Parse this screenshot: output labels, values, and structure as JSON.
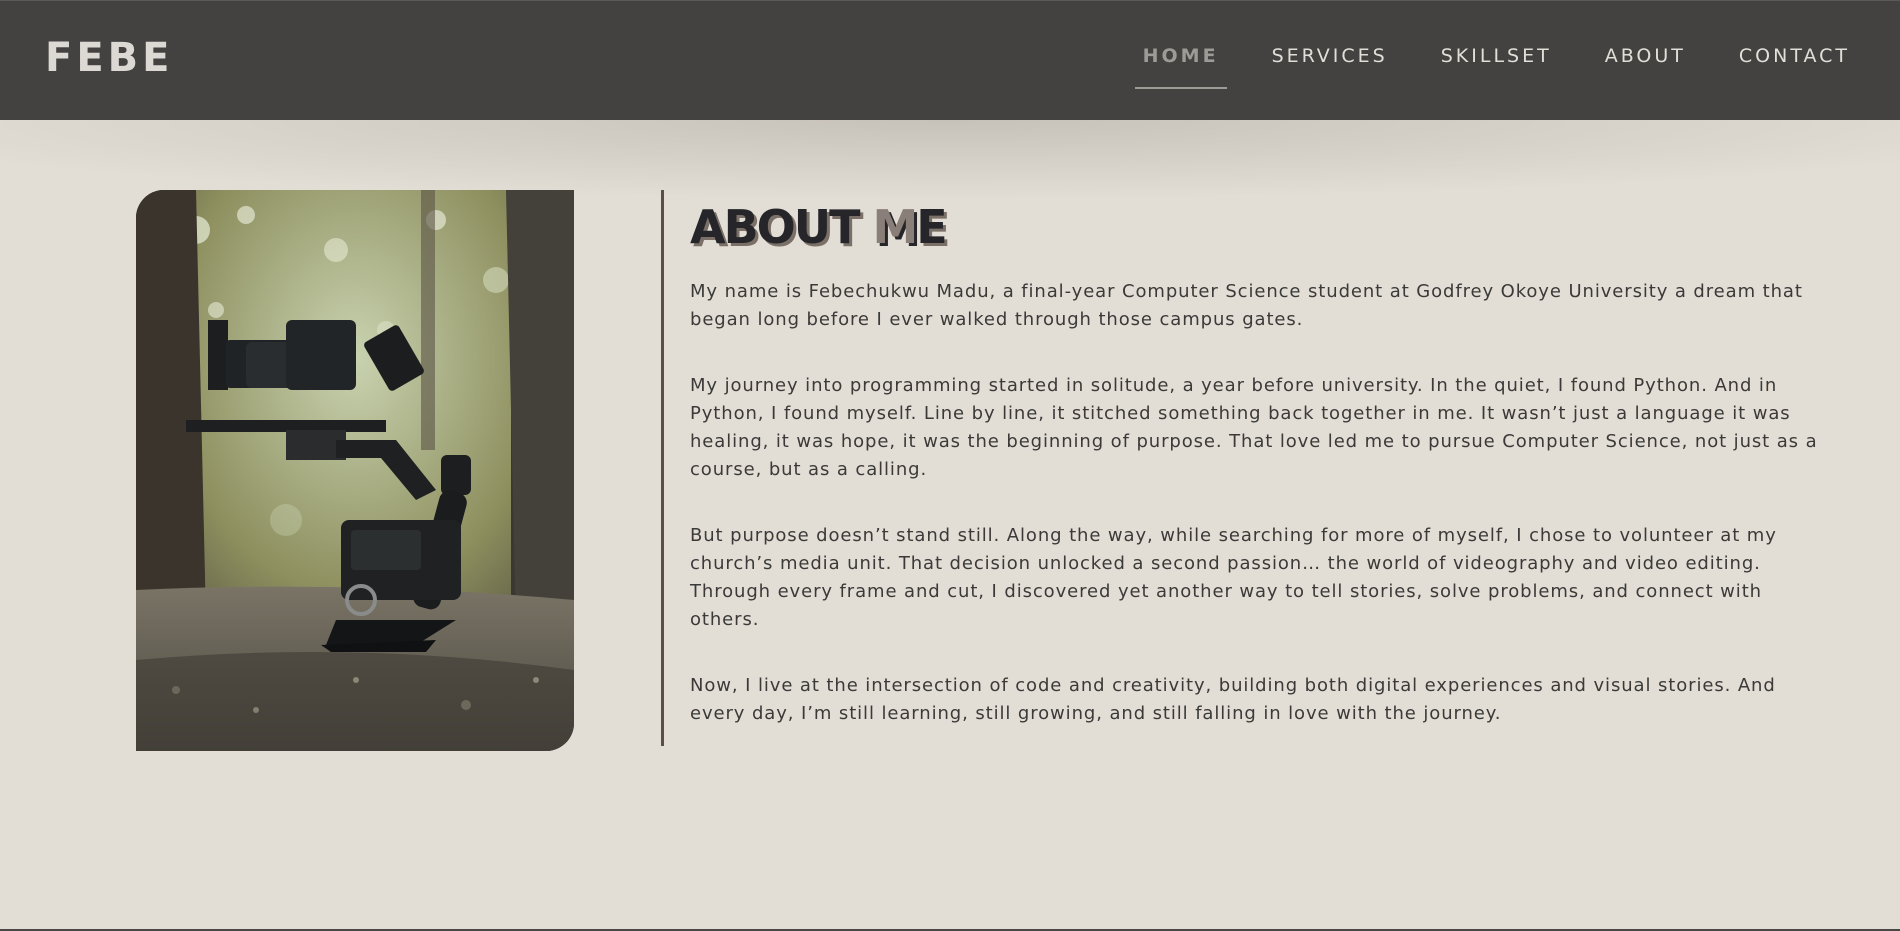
{
  "header": {
    "logo": "FEBE",
    "nav": [
      {
        "label": "HOME",
        "active": true
      },
      {
        "label": "SERVICES",
        "active": false
      },
      {
        "label": "SKILLSET",
        "active": false
      },
      {
        "label": "ABOUT",
        "active": false
      },
      {
        "label": "CONTACT",
        "active": false
      }
    ]
  },
  "about": {
    "title_part1": "ABOUT ",
    "title_part2": "M",
    "title_part3": "E",
    "paragraphs": [
      "My name is Febechukwu Madu, a final-year Computer Science student at Godfrey Okoye University a dream that began long before I ever walked through those campus gates.",
      "My journey into programming started in solitude, a year before university. In the quiet, I found Python. And in Python, I found myself. Line by line, it stitched something back together in me. It wasn’t just a language it was healing, it was hope, it was the beginning of purpose. That love led me to pursue Computer Science, not just as a course, but as a calling.",
      "But purpose doesn’t stand still. Along the way, while searching for more of myself, I chose to volunteer at my church’s media unit. That decision unlocked a second passion… the world of videography and video editing. Through every frame and cut, I discovered yet another way to tell stories, solve problems, and connect with others.",
      "Now, I live at the intersection of code and creativity, building both digital experiences and visual stories. And every day, I’m still learning, still growing, and still falling in love with the journey."
    ]
  },
  "colors": {
    "navbar": "#434240",
    "background": "#e2ded6",
    "accent_divider": "#5b4e44",
    "title": "#26262a"
  }
}
